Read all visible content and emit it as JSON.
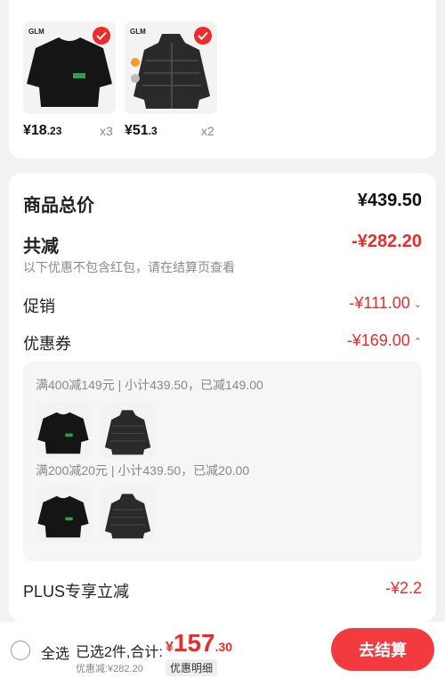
{
  "items": [
    {
      "price_int": "¥18",
      "price_dec": ".23",
      "qty": "x3",
      "brand": "GLM",
      "name": "black-sweatshirt"
    },
    {
      "price_int": "¥51",
      "price_dec": ".3",
      "qty": "x2",
      "brand": "GLM",
      "name": "black-puffer-jacket"
    }
  ],
  "summary": {
    "total_label": "商品总价",
    "total_value": "¥439.50",
    "reduce_label": "共减",
    "reduce_value": "-¥282.20",
    "note": "以下优惠不包含红包，请在结算页查看",
    "promo_label": "促销",
    "promo_value": "-¥111.00",
    "coupon_label": "优惠券",
    "coupon_value": "-¥169.00",
    "coupons": [
      {
        "text": "满400减149元 | 小计439.50，已减149.00"
      },
      {
        "text": "满200减20元 | 小计439.50，已减20.00"
      }
    ],
    "plus_label": "PLUS专享立减",
    "plus_value": "-¥2.2"
  },
  "bottom": {
    "select_all": "全选",
    "selected_info": "已选2件,合计:",
    "total_cur": "¥",
    "total_int": "157",
    "total_dec": ".30",
    "discount": "优惠减:¥282.20",
    "detail": "优惠明细",
    "checkout": "去结算"
  },
  "colors": {
    "accent": "#ee2a2a",
    "button": "#f23a3f"
  },
  "icons": [
    "check-icon",
    "chevron-down-icon",
    "chevron-up-icon",
    "radio-icon"
  ]
}
